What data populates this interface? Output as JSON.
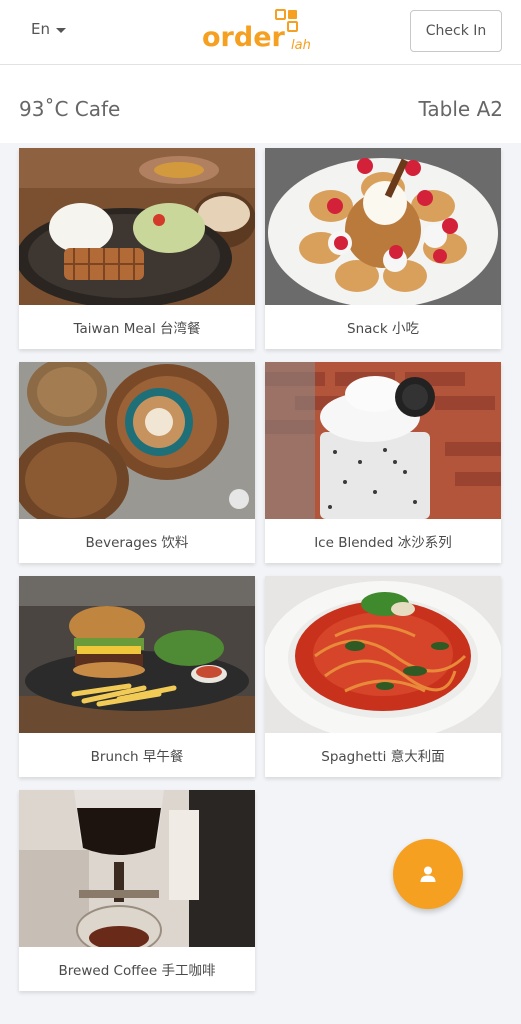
{
  "topbar": {
    "language": "En",
    "logo_main": "order",
    "logo_sub": "lah",
    "checkin_label": "Check In"
  },
  "header": {
    "cafe_name": "93˚C Cafe",
    "table": "Table A2"
  },
  "menu": {
    "categories": [
      {
        "label": "Taiwan Meal 台湾餐"
      },
      {
        "label": "Snack 小吃"
      },
      {
        "label": "Beverages 饮料"
      },
      {
        "label": "Ice Blended 冰沙系列"
      },
      {
        "label": "Brunch 早午餐"
      },
      {
        "label": "Spaghetti 意大利面"
      },
      {
        "label": "Brewed Coffee 手工咖啡"
      }
    ]
  },
  "colors": {
    "brand": "#f5a021",
    "background": "#f2f4f7"
  },
  "fab": {
    "icon": "user-icon"
  }
}
